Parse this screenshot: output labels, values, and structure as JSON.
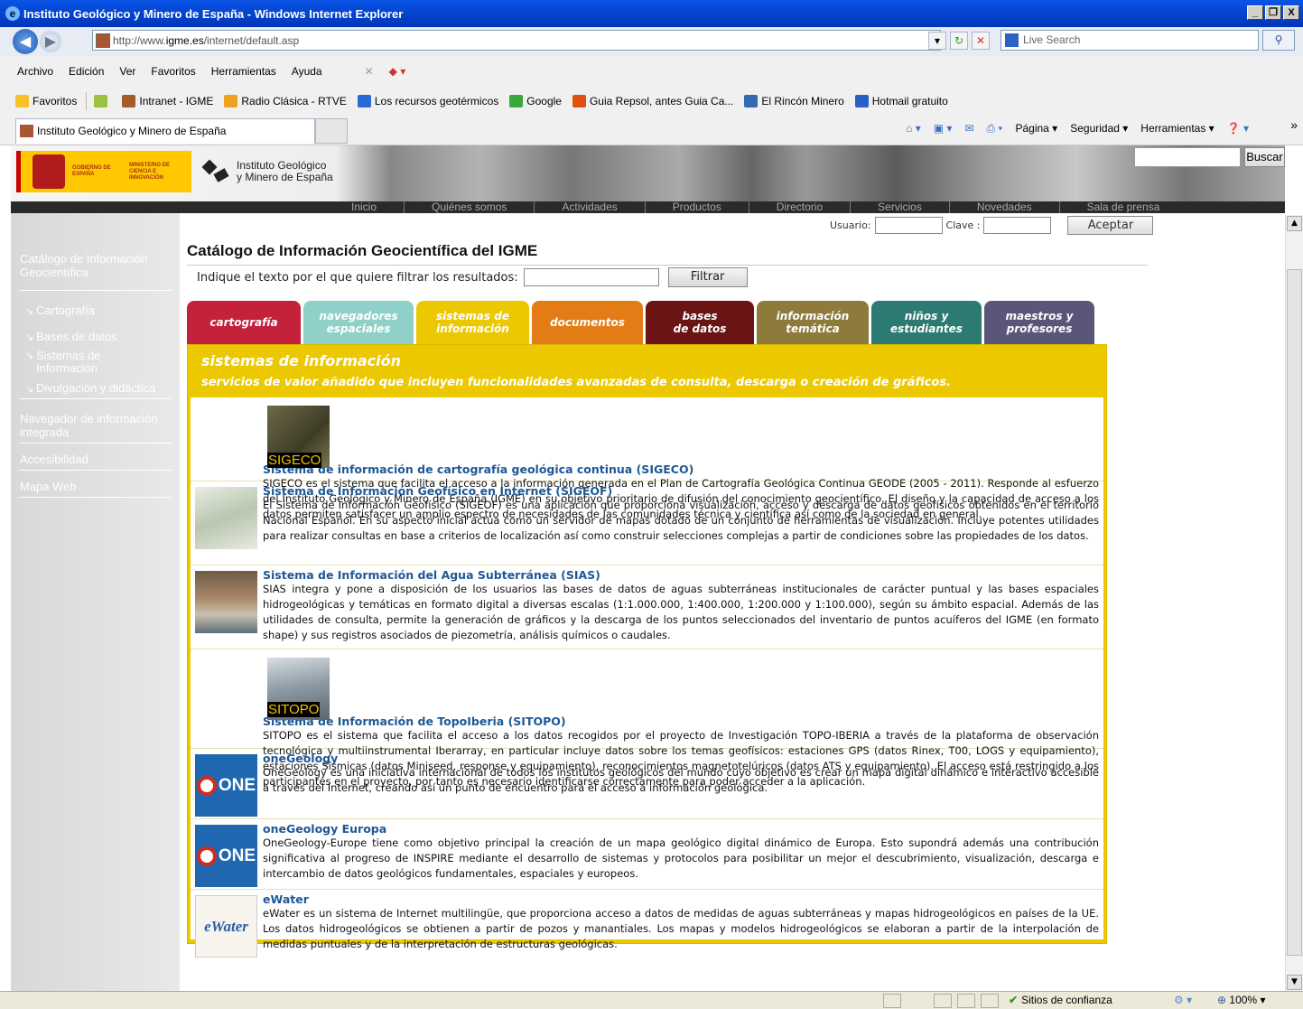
{
  "window": {
    "title": "Instituto Geológico y Minero de España - Windows Internet Explorer",
    "buttons": [
      "_",
      "д",
      "X"
    ]
  },
  "address": {
    "url_prefix": "http://www.",
    "url_domain": "igme.es",
    "url_rest": "/internet/default.asp",
    "search_placeholder": "Live Search"
  },
  "menu": [
    "Archivo",
    "Edición",
    "Ver",
    "Favoritos",
    "Herramientas",
    "Ayuda"
  ],
  "favorites": {
    "label": "Favoritos",
    "items": [
      {
        "label": "Intranet - IGME",
        "color": "#a65a2a"
      },
      {
        "label": "Radio Clásica - RTVE",
        "color": "#f0a020"
      },
      {
        "label": "Los recursos geotérmicos",
        "color": "#2a6ad8"
      },
      {
        "label": "Google",
        "color": "#3ca83c"
      },
      {
        "label": "Guia Repsol, antes Guia Ca...",
        "color": "#e05010"
      },
      {
        "label": "El Rincón Minero",
        "color": "#3468b0"
      },
      {
        "label": "Hotmail gratuito",
        "color": "#2860c8"
      }
    ]
  },
  "tab": {
    "label": "Instituto Geológico y Minero de España"
  },
  "commands": [
    "Página ▾",
    "Seguridad ▾",
    "Herramientas ▾"
  ],
  "site": {
    "gov_text": "GOBIERNO DE ESPAÑA",
    "ministry_text": "MINISTERIO DE CIENCIA E INNOVACIÓN",
    "logo_line1": "Instituto Geológico",
    "logo_line2": "y Minero de España",
    "search_button": "Buscar",
    "topnav": [
      "Inicio",
      "Quiénes somos",
      "Actividades",
      "Productos",
      "Directorio",
      "Servicios",
      "Novedades",
      "Sala de prensa"
    ],
    "login_user": "Usuario:",
    "login_pass": "Clave :",
    "login_button": "Aceptar"
  },
  "sidebar": {
    "catalog": "Catálogo de Información Geocientífica",
    "subs": [
      "Cartografía",
      "Bases de datos",
      "Sistemas de Información",
      "Divulgación y didáctica"
    ],
    "links": [
      "Navegador de información integrada",
      "Accesibilidad",
      "Mapa Web"
    ]
  },
  "main": {
    "title": "Catálogo de Información Geocientífica del IGME",
    "filter_label": "Indique el texto por el que quiere filtrar los resultados:",
    "filter_button": "Filtrar",
    "tabs": [
      {
        "label": "cartografía",
        "color": "#c4213a"
      },
      {
        "label": "navegadores espaciales",
        "color": "#8fd0c8"
      },
      {
        "label": "sistemas de información",
        "color": "#ecc800"
      },
      {
        "label": "documentos",
        "color": "#e37c16"
      },
      {
        "label": "bases de datos",
        "color": "#6a1414"
      },
      {
        "label": "información temática",
        "color": "#8e7a3a"
      },
      {
        "label": "niños y estudiantes",
        "color": "#2c7a72"
      },
      {
        "label": "maestros y profesores",
        "color": "#5a567a"
      }
    ],
    "panel_title": "sistemas de información",
    "panel_desc": "servicios de valor añadido que incluyen funcionalidades avanzadas de consulta, descarga o creación de gráficos.",
    "entries": [
      {
        "title": "Sistema de información de cartografía geológica continua (SIGECO)",
        "thumb": "SIGECO",
        "thumb_bg": "#5d5a3c",
        "text": "SIGECO es el sistema que facilita el acceso a la información generada en el Plan de Cartografía Geológica Continua GEODE (2005 - 2011). Responde al esfuerzo del Instituto Geológico y Minero de España (IGME) en su objetivo prioritario de difusión del conocimiento geocientífico. El diseño y la capacidad de acceso a los datos permiten satisfacer un amplio espectro de necesidades de las comunidades técnica y científica así como de la sociedad en general."
      },
      {
        "title": "Sistema de Información Geofísico en Internet (SIGEOF)",
        "thumb": "",
        "thumb_bg": "#cfd8c8",
        "text": "El Sistema de Información Geofísico (SIGEOF) es una aplicación que proporciona visualización, acceso y descarga de datos geofísicos obtenidos en el territorio Nacional Español. En su aspecto inicial actúa como un servidor de mapas dotado de un conjunto de herramientas de visualización. Incluye potentes utilidades para realizar consultas en base a criterios de localización así como construir selecciones complejas a partir de condiciones sobre las propiedades de los datos."
      },
      {
        "title": "Sistema de Información del Agua Subterránea (SIAS)",
        "thumb": "",
        "thumb_bg": "#8a6a4a",
        "text": "SIAS integra y pone a disposición de los usuarios las bases de datos de aguas subterráneas institucionales de carácter puntual y las bases espaciales hidrogeológicas y temáticas en formato digital a diversas escalas (1:1.000.000, 1:400.000, 1:200.000 y 1:100.000), según su ámbito espacial. Además de las utilidades de consulta, permite la generación de gráficos y la descarga de los puntos seleccionados del inventario de puntos acuíferos del IGME (en formato shape) y sus registros asociados de piezometría, análisis químicos o caudales."
      },
      {
        "title": "Sistema de Información de TopoIberia (SITOPO)",
        "thumb": "SITOPO",
        "thumb_bg": "#8a9aa8",
        "text": "SITOPO es el sistema que facilita el acceso a los datos recogidos por el proyecto de Investigación TOPO-IBERIA a través de la plataforma de observación tecnológica y multiinstrumental Iberarray, en particular incluye datos sobre los temas geofísicos: estaciones GPS (datos Rinex, T00, LOGS y equipamiento), estaciones Sísmicas (datos Miniseed, response y equipamiento), reconocimientos magnetotelúricos (datos ATS y equipamiento). El acceso está restringido a los participantes en el proyecto, por tanto es necesario identificarse correctamente para poder acceder a la aplicación."
      },
      {
        "title": "oneGeology",
        "thumb": "ONE",
        "thumb_bg": "#1f67b0",
        "text": "OneGeology es una iniciativa internacional de todos los institutos geológicos del mundo cuyo objetivo es crear un mapa digital dinámico e interactivo accesible a través del Internet, creando así un punto de encuentro para el acceso a información geológica."
      },
      {
        "title": "oneGeology Europa",
        "thumb": "ONE",
        "thumb_bg": "#1f67b0",
        "text": "OneGeology-Europe tiene como objetivo principal la creación de un mapa geológico digital dinámico de Europa. Esto supondrá además una contribución significativa al progreso de INSPIRE mediante el desarrollo de sistemas y protocolos para posibilitar un mejor el descubrimiento, visualización, descarga e intercambio de datos geológicos fundamentales, espaciales y europeos."
      },
      {
        "title": "eWater",
        "thumb": "eWater",
        "thumb_bg": "#f4f2ea",
        "text": "eWater es un sistema de Internet multilingüe, que proporciona acceso a datos de medidas de aguas subterráneas y mapas hidrogeológicos en países de la UE. Los datos hidrogeológicos se obtienen a partir de pozos y manantiales. Los mapas y modelos hidrogeológicos se elaboran a partir de la interpolación de medidas puntuales y de la interpretación de estructuras geológicas."
      }
    ]
  },
  "status": {
    "zone": "Sitios de confianza",
    "zoom": "100%"
  }
}
